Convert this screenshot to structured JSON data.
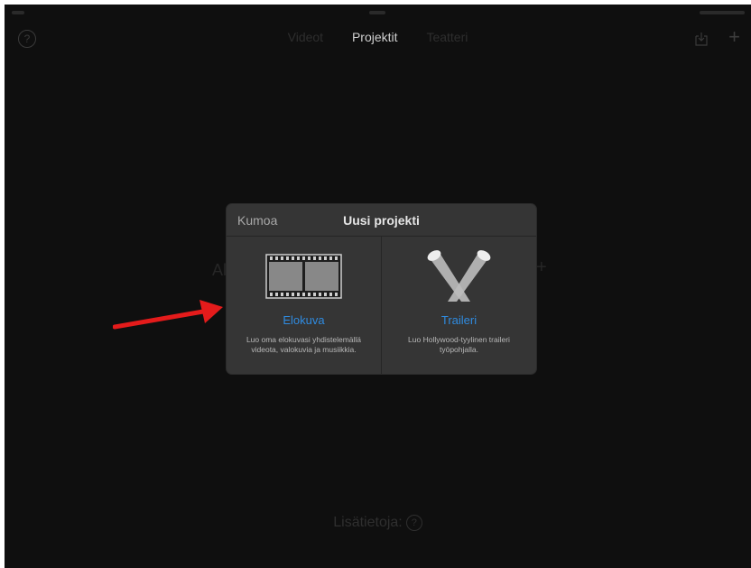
{
  "nav": {
    "tabs": [
      {
        "label": "Videot",
        "active": false
      },
      {
        "label": "Projektit",
        "active": true
      },
      {
        "label": "Teatteri",
        "active": false
      }
    ],
    "help_icon": "?",
    "plus_icon": "+"
  },
  "background": {
    "left_text": "Al",
    "footer_label": "Lisätietoja:",
    "footer_icon": "?"
  },
  "dialog": {
    "cancel_label": "Kumoa",
    "title": "Uusi projekti",
    "options": [
      {
        "title": "Elokuva",
        "description": "Luo oma elokuvasi yhdistelemällä videota, valokuvia ja musiikkia.",
        "icon": "film-strip-icon"
      },
      {
        "title": "Traileri",
        "description": "Luo Hollywood-tyylinen traileri työpohjalla.",
        "icon": "spotlights-icon"
      }
    ]
  },
  "colors": {
    "background": "#0f0f0f",
    "dialog": "#353535",
    "accent": "#2f8be0",
    "arrow": "#e41b1b"
  }
}
